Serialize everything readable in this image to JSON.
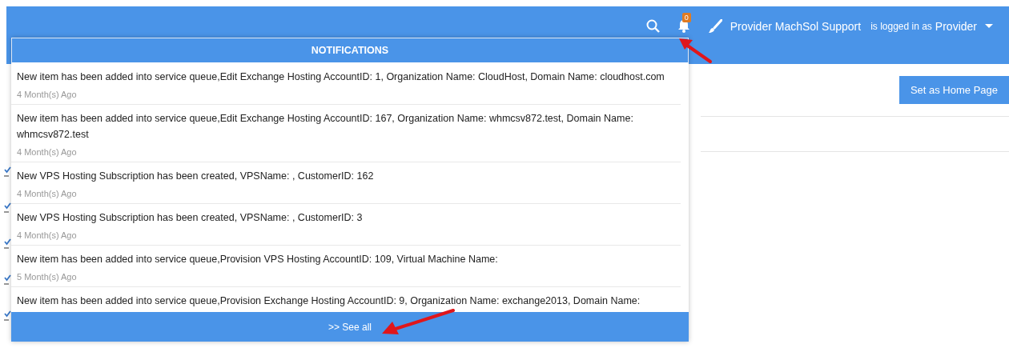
{
  "top_bar": {
    "notification_badge": "0",
    "user_name": "Provider MachSol Support",
    "logged_in_label": "is logged in as",
    "role": "Provider"
  },
  "notifications": {
    "title": "NOTIFICATIONS",
    "items": [
      {
        "message": "New item has been added into service queue,Edit Exchange Hosting AccountID: 1, Organization Name: CloudHost, Domain Name: cloudhost.com",
        "time": "4 Month(s) Ago"
      },
      {
        "message": "New item has been added into service queue,Edit Exchange Hosting AccountID: 167, Organization Name: whmcsv872.test, Domain Name: whmcsv872.test",
        "time": "4 Month(s) Ago"
      },
      {
        "message": "New VPS Hosting Subscription has been created, VPSName: , CustomerID: 162",
        "time": "4 Month(s) Ago"
      },
      {
        "message": "New VPS Hosting Subscription has been created, VPSName: , CustomerID: 3",
        "time": "4 Month(s) Ago"
      },
      {
        "message": "New item has been added into service queue,Provision VPS Hosting AccountID: 109, Virtual Machine Name:",
        "time": "5 Month(s) Ago"
      },
      {
        "message": "New item has been added into service queue,Provision Exchange Hosting AccountID: 9, Organization Name: exchange2013, Domain Name:"
      }
    ],
    "see_all": ">> See all"
  },
  "page": {
    "home_button": "Set as Home Page"
  }
}
